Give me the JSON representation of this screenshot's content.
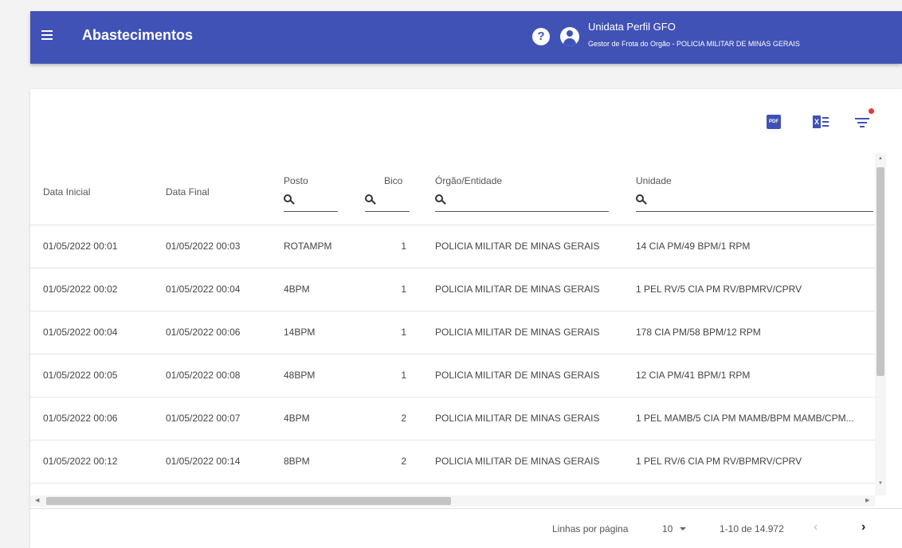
{
  "header": {
    "title": "Abastecimentos",
    "user_name": "Unidata Perfil GFO",
    "user_role": "Gestor de Frota do Orgão - POLICIA MILITAR DE MINAS GERAIS",
    "help_glyph": "?",
    "bar_color": "#4052b5"
  },
  "toolbar": {
    "icons": [
      "pdf-icon",
      "excel-icon",
      "filter-icon"
    ],
    "pdf_text": "PDF",
    "xls_text": "X",
    "filter_active_color": "#e53935"
  },
  "table": {
    "columns": {
      "data_inicial": "Data Inicial",
      "data_final": "Data Final",
      "posto": "Posto",
      "bico": "Bico",
      "orgao": "Órgão/Entidade",
      "unidade": "Unidade"
    },
    "rows": [
      {
        "data_inicial": "01/05/2022 00:01",
        "data_final": "01/05/2022 00:03",
        "posto": "ROTAMPM",
        "bico": "1",
        "orgao": "POLICIA MILITAR DE MINAS GERAIS",
        "unidade": "14 CIA PM/49 BPM/1 RPM"
      },
      {
        "data_inicial": "01/05/2022 00:02",
        "data_final": "01/05/2022 00:04",
        "posto": "4BPM",
        "bico": "1",
        "orgao": "POLICIA MILITAR DE MINAS GERAIS",
        "unidade": "1 PEL RV/5 CIA PM RV/BPMRV/CPRV"
      },
      {
        "data_inicial": "01/05/2022 00:04",
        "data_final": "01/05/2022 00:06",
        "posto": "14BPM",
        "bico": "1",
        "orgao": "POLICIA MILITAR DE MINAS GERAIS",
        "unidade": "178 CIA PM/58 BPM/12 RPM"
      },
      {
        "data_inicial": "01/05/2022 00:05",
        "data_final": "01/05/2022 00:08",
        "posto": "48BPM",
        "bico": "1",
        "orgao": "POLICIA MILITAR DE MINAS GERAIS",
        "unidade": "12 CIA PM/41 BPM/1 RPM"
      },
      {
        "data_inicial": "01/05/2022 00:06",
        "data_final": "01/05/2022 00:07",
        "posto": "4BPM",
        "bico": "2",
        "orgao": "POLICIA MILITAR DE MINAS GERAIS",
        "unidade": "1 PEL MAMB/5 CIA PM MAMB/BPM MAMB/CPM..."
      },
      {
        "data_inicial": "01/05/2022 00:12",
        "data_final": "01/05/2022 00:14",
        "posto": "8BPM",
        "bico": "2",
        "orgao": "POLICIA MILITAR DE MINAS GERAIS",
        "unidade": "1 PEL RV/6 CIA PM RV/BPMRV/CPRV"
      }
    ]
  },
  "pagination": {
    "rows_label": "Linhas por página",
    "rows_value": "10",
    "range": "1-10 de 14.972",
    "prev_glyph": "‹",
    "next_glyph": "›"
  }
}
